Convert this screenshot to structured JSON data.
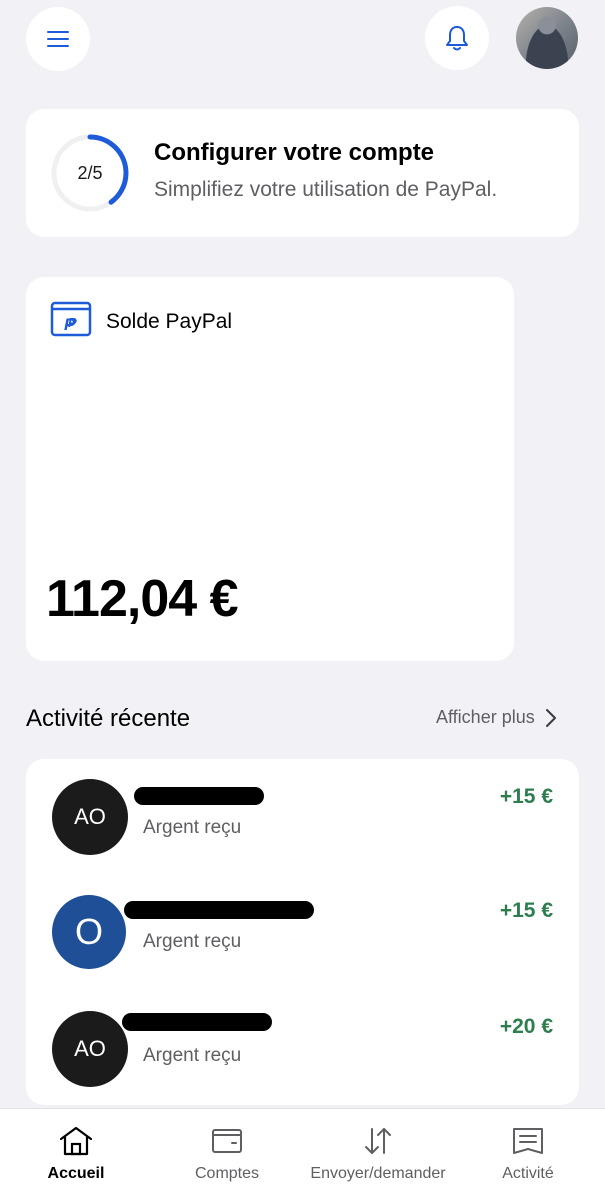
{
  "header": {
    "menu_icon": "hamburger-menu-icon",
    "bell_icon": "bell-icon",
    "avatar": "profile-photo"
  },
  "setup": {
    "progress": "2/5",
    "progress_fraction": 0.4,
    "title": "Configurer votre compte",
    "subtitle": "Simplifiez votre utilisation de PayPal."
  },
  "balance": {
    "icon": "paypal-wallet-icon",
    "label": "Solde PayPal",
    "amount": "112,04 €"
  },
  "recent": {
    "title": "Activité récente",
    "show_more": "Afficher plus",
    "items": [
      {
        "initials": "AO",
        "status": "Argent reçu",
        "amount": "+15 €"
      },
      {
        "initials": "O",
        "status": "Argent reçu",
        "amount": "+15 €"
      },
      {
        "initials": "AO",
        "status": "Argent reçu",
        "amount": "+20 €"
      }
    ]
  },
  "nav": {
    "home": "Accueil",
    "accounts": "Comptes",
    "send": "Envoyer/demander",
    "activity": "Activité"
  },
  "colors": {
    "background": "#f1f1f6",
    "accent": "#1d5bd8",
    "positive": "#2e7d4f",
    "avatar_blue": "#1f4f96"
  }
}
